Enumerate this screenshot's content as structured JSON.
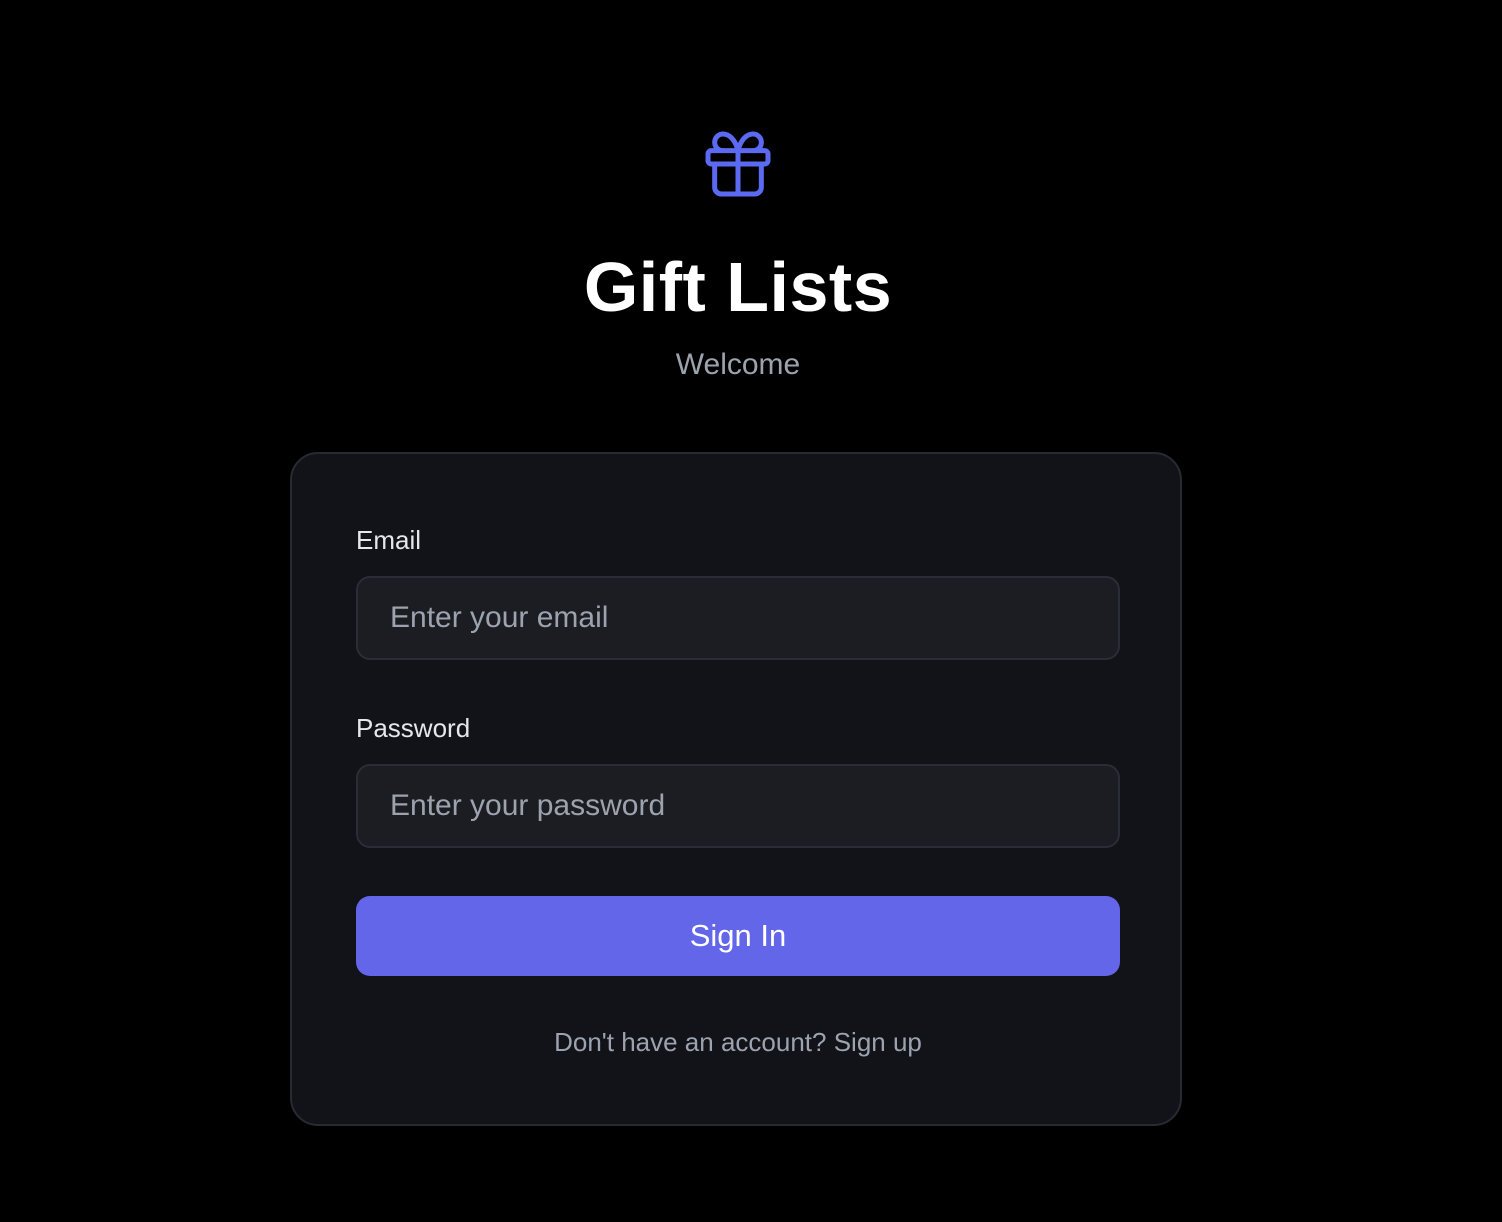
{
  "header": {
    "logo_icon": "gift-icon",
    "accent_color": "#6366f1",
    "title": "Gift Lists",
    "subtitle": "Welcome"
  },
  "form": {
    "email_label": "Email",
    "email_placeholder": "Enter your email",
    "email_value": "",
    "password_label": "Password",
    "password_placeholder": "Enter your password",
    "password_value": "",
    "submit_label": "Sign In",
    "signup_link": "Don't have an account? Sign up"
  }
}
